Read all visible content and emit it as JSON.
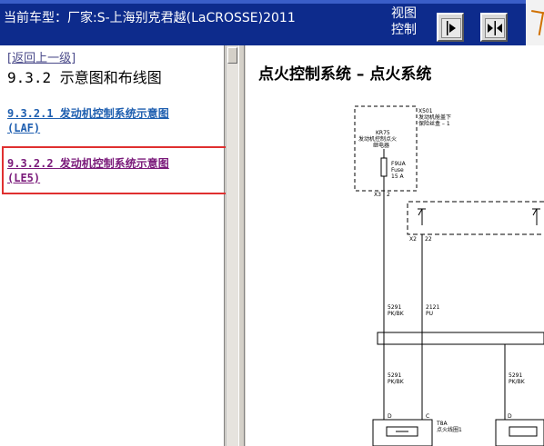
{
  "header": {
    "car_title": "当前车型：厂家:S-上海别克君越(LaCROSSE)2011",
    "view_label_line1": "视图",
    "view_label_line2": "控制"
  },
  "left": {
    "back_link": "[返回上一级]",
    "section_title": "9.3.2 示意图和布线图",
    "links": [
      {
        "line1": "9.3.2.1 发动机控制系统示意图",
        "line2": "(LAF)"
      },
      {
        "line1": "9.3.2.2 发动机控制系统示意图",
        "line2": "(LE5)"
      }
    ]
  },
  "diagram": {
    "title": "点火控制系统 – 点火系统",
    "labels": {
      "x501": "X501",
      "x501_desc1": "发动机舱盖下",
      "x501_desc2": "保险丝盒 – 1",
      "kr75": "KR75",
      "kr75_desc1": "发动机控制点火",
      "kr75_desc2": "继电器",
      "fuse_id": "F9UA",
      "fuse_word": "Fuse",
      "fuse_amp": "15 A",
      "x3": "X3",
      "pin2": "2",
      "x2": "X2",
      "pin22": "22",
      "w1_circuit": "5291",
      "w1_color": "PK/BK",
      "w2_circuit": "2121",
      "w2_color": "PU",
      "w3_circuit": "5291",
      "w3_color": "PK/BK",
      "w4_circuit": "5291",
      "w4_color": "PK/BK",
      "pin_d1": "D",
      "pin_c1": "C",
      "pin_d2": "D",
      "t8a": "T8A",
      "t8a_desc": "点火线圈1"
    }
  }
}
